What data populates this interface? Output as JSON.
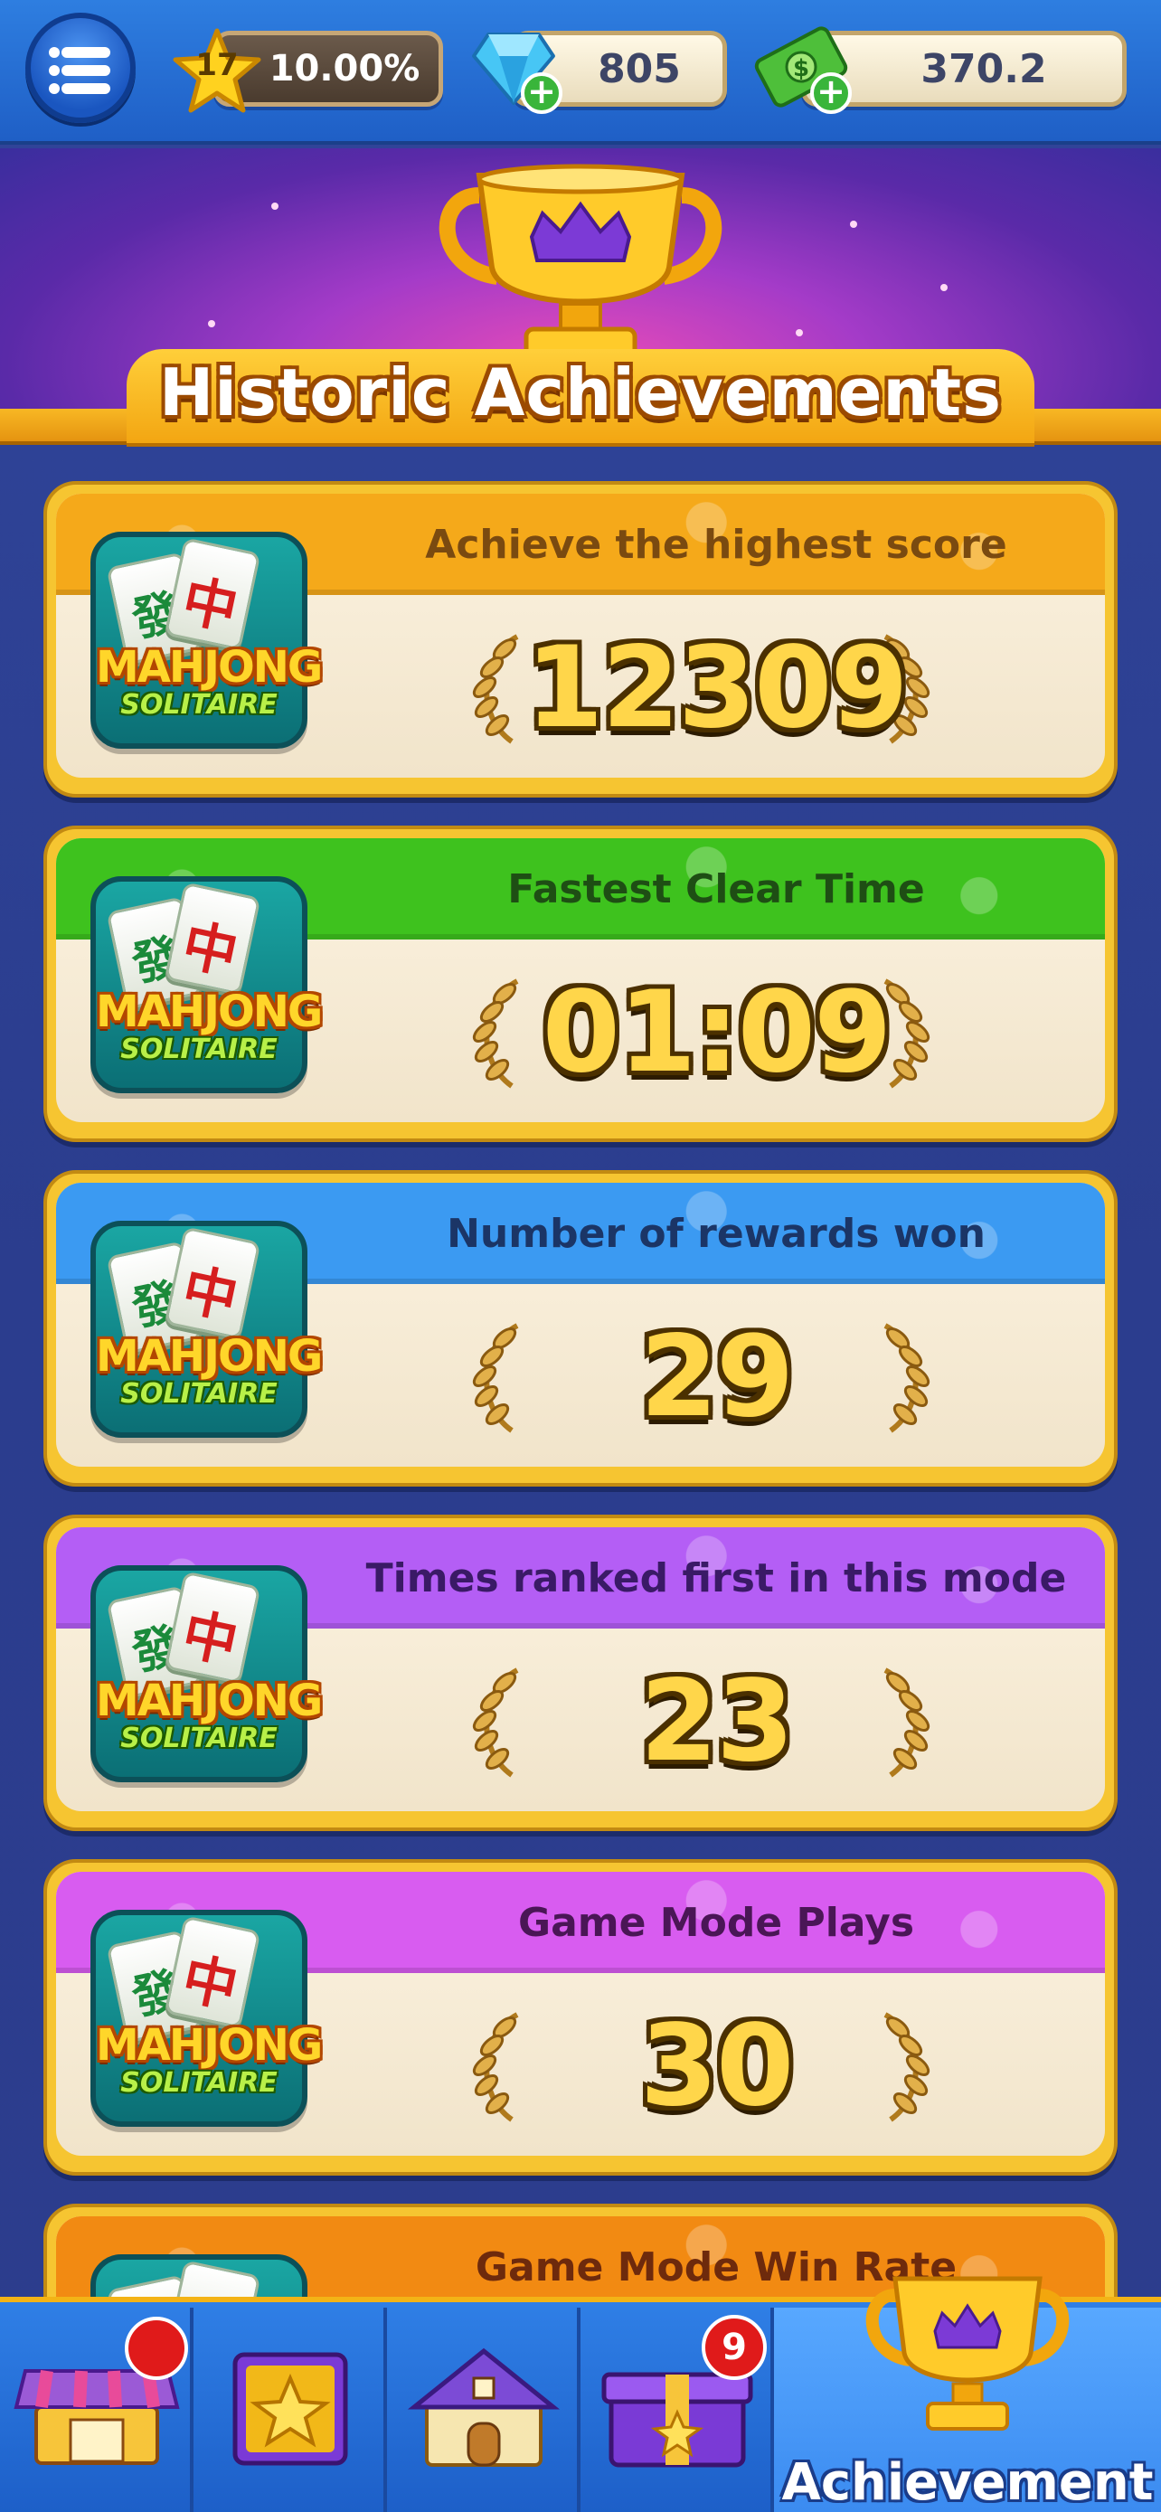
{
  "topbar": {
    "level": "17",
    "level_progress": "10.00%",
    "gems": "805",
    "cash": "370.2",
    "icons": [
      "menu-icon",
      "star-icon",
      "gem-icon",
      "cash-icon",
      "plus-icon"
    ]
  },
  "header": {
    "title": "Historic Achievements"
  },
  "app_logo": {
    "tile_left": "發",
    "tile_right": "中",
    "title": "MAHJONG",
    "subtitle": "SOLITAIRE"
  },
  "cards": [
    {
      "label": "Achieve the highest score",
      "value": "12309",
      "color": "#f5a91a",
      "text_color": "#7a4a10"
    },
    {
      "label": "Fastest Clear Time",
      "value": "01:09",
      "color": "#3ec21e",
      "text_color": "#1e4e14"
    },
    {
      "label": "Number of rewards won",
      "value": "29",
      "color": "#3b9af2",
      "text_color": "#1b3566"
    },
    {
      "label": "Times ranked first in this mode",
      "value": "23",
      "color": "#b45ef5",
      "text_color": "#3a1a66"
    },
    {
      "label": "Game Mode Plays",
      "value": "30",
      "color": "#d85cf0",
      "text_color": "#4a1656"
    },
    {
      "label": "Game Mode Win Rate",
      "value": "",
      "color": "#f28a12",
      "text_color": "#6e2a0c"
    }
  ],
  "bottomnav": {
    "items": [
      {
        "name": "shop",
        "icon": "shop-icon"
      },
      {
        "name": "album",
        "icon": "star-book-icon"
      },
      {
        "name": "home",
        "icon": "house-icon"
      },
      {
        "name": "gifts",
        "icon": "gift-icon",
        "badge": "9"
      },
      {
        "name": "achievement",
        "icon": "trophy-icon",
        "label": "Achievement"
      }
    ]
  }
}
